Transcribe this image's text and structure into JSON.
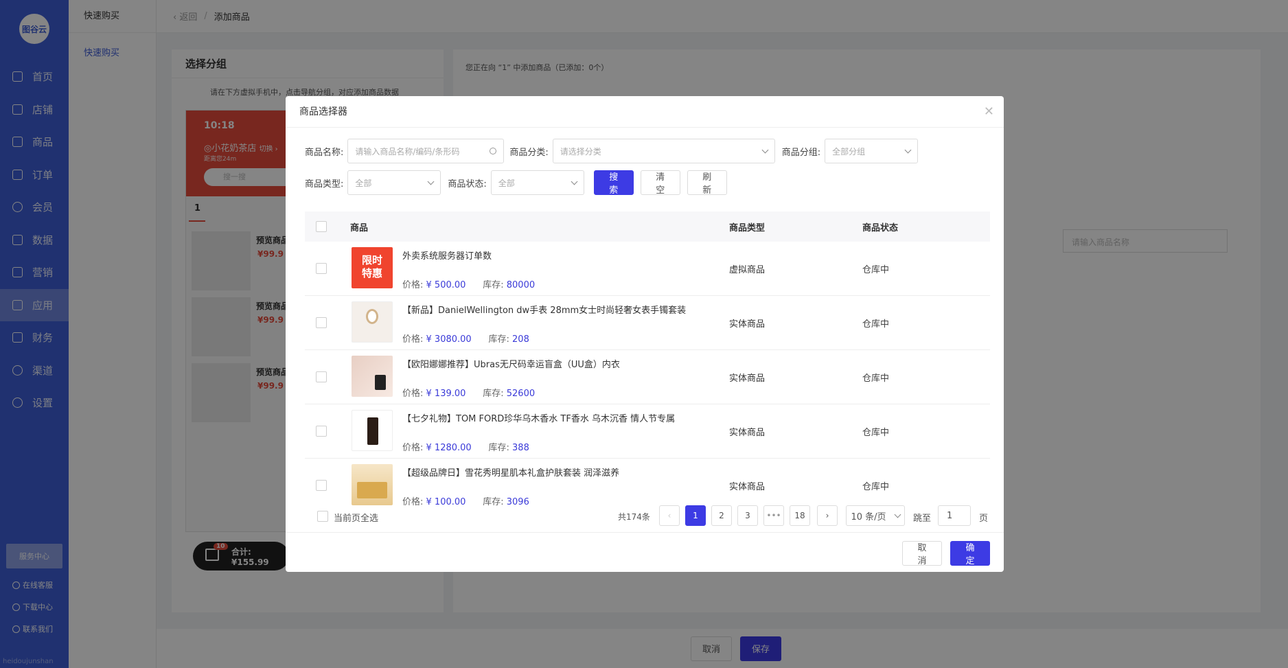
{
  "sidebar": {
    "logo": "图谷云",
    "items": [
      {
        "label": "首页",
        "icon": "home-icon"
      },
      {
        "label": "店铺",
        "icon": "shop-icon"
      },
      {
        "label": "商品",
        "icon": "goods-icon"
      },
      {
        "label": "订单",
        "icon": "order-icon"
      },
      {
        "label": "会员",
        "icon": "user-icon"
      },
      {
        "label": "数据",
        "icon": "chart-icon"
      },
      {
        "label": "营销",
        "icon": "tag-icon"
      },
      {
        "label": "应用",
        "icon": "app-icon"
      },
      {
        "label": "财务",
        "icon": "finance-icon"
      },
      {
        "label": "渠道",
        "icon": "channel-icon"
      },
      {
        "label": "设置",
        "icon": "gear-icon"
      }
    ],
    "service_center": "服务中心",
    "online_service": "在线客服",
    "download_center": "下载中心",
    "contact_us": "联系我们",
    "watermark": "heidoujunshan"
  },
  "subnav": {
    "title": "快速购买",
    "link": "快速购买"
  },
  "breadcrumb": {
    "back": "返回",
    "sep": "/",
    "current": "添加商品"
  },
  "left_panel": {
    "title": "选择分组",
    "tip": "请在下方虚拟手机中，点击导航分组，对应添加商品数据",
    "phone": {
      "time": "10:18",
      "store": "◎小花奶茶店",
      "switch": "切换 ›",
      "distance": "距离您24m",
      "search": "搜一搜",
      "tab": "1",
      "items": [
        {
          "name": "预览商品",
          "price": "¥99.9"
        },
        {
          "name": "预览商品",
          "price": "¥99.9"
        },
        {
          "name": "预览商品",
          "price": "¥99.9"
        }
      ],
      "cart_badge": "10",
      "cart_total": "合计: ¥155.99"
    }
  },
  "right_panel": {
    "info": "您正在向 “1” 中添加商品（已添加：0个）",
    "search_placeholder": "请输入商品名称"
  },
  "footer": {
    "cancel": "取消",
    "save": "保存"
  },
  "modal": {
    "title": "商品选择器",
    "filters": {
      "name_label": "商品名称:",
      "name_placeholder": "请输入商品名称/编码/条形码",
      "category_label": "商品分类:",
      "category_placeholder": "请选择分类",
      "group_label": "商品分组:",
      "group_value": "全部分组",
      "type_label": "商品类型:",
      "type_value": "全部",
      "status_label": "商品状态:",
      "status_value": "全部",
      "search_btn": "搜索",
      "clear_btn": "清空",
      "refresh_btn": "刷新"
    },
    "table": {
      "headers": [
        "商品",
        "商品类型",
        "商品状态"
      ],
      "price_label": "价格:",
      "stock_label": "库存:",
      "rows": [
        {
          "name": "外卖系统服务器订单数",
          "price": "¥ 500.00",
          "stock": "80000",
          "type": "虚拟商品",
          "status": "仓库中",
          "thumb": "限时特惠"
        },
        {
          "name": "【新品】DanielWellington dw手表 28mm女士时尚轻奢女表手镯套装",
          "price": "¥ 3080.00",
          "stock": "208",
          "type": "实体商品",
          "status": "仓库中",
          "thumb": ""
        },
        {
          "name": "【欧阳娜娜推荐】Ubras无尺码幸运盲盒（UU盒）内衣",
          "price": "¥ 139.00",
          "stock": "52600",
          "type": "实体商品",
          "status": "仓库中",
          "thumb": ""
        },
        {
          "name": "【七夕礼物】TOM FORD珍华乌木香水 TF香水 乌木沉香 情人节专属",
          "price": "¥ 1280.00",
          "stock": "388",
          "type": "实体商品",
          "status": "仓库中",
          "thumb": ""
        },
        {
          "name": "【超级品牌日】雪花秀明星肌本礼盒护肤套装 润泽滋养",
          "price": "¥ 100.00",
          "stock": "3096",
          "type": "实体商品",
          "status": "仓库中",
          "thumb": ""
        }
      ]
    },
    "select_page": "当前页全选",
    "pagination": {
      "total": "共174条",
      "pages": [
        "1",
        "2",
        "3",
        "•••",
        "18"
      ],
      "page_size": "10 条/页",
      "jump_label": "跳至",
      "jump_value": "1",
      "page_unit": "页"
    },
    "cancel": "取消",
    "confirm": "确定"
  }
}
